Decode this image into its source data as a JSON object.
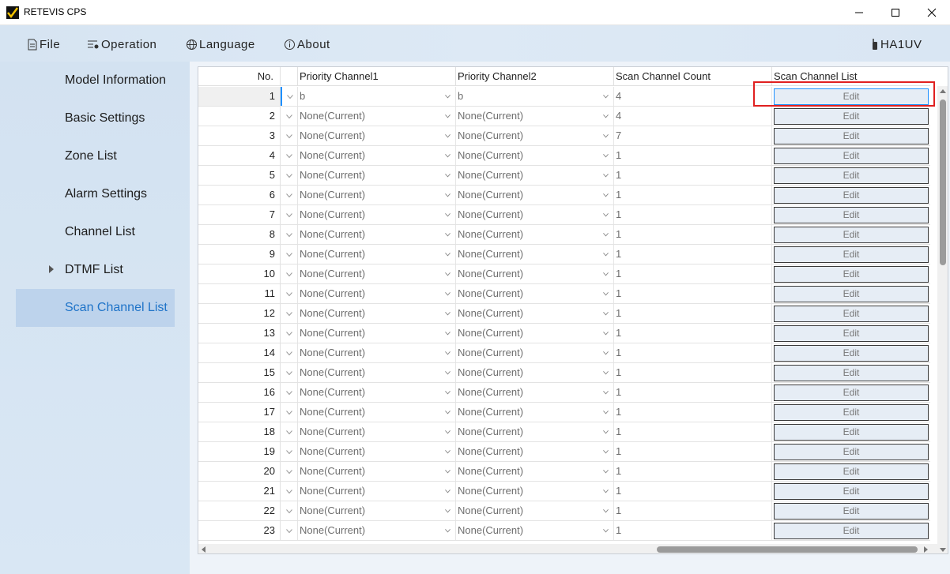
{
  "window": {
    "title": "RETEVIS CPS"
  },
  "menu": {
    "file": "File",
    "operation": "Operation",
    "language": "Language",
    "about": "About",
    "user": "HA1UV"
  },
  "sidebar": {
    "items": [
      {
        "label": "Model Information",
        "active": false,
        "expandable": false
      },
      {
        "label": "Basic Settings",
        "active": false,
        "expandable": false
      },
      {
        "label": "Zone List",
        "active": false,
        "expandable": false
      },
      {
        "label": "Alarm Settings",
        "active": false,
        "expandable": false
      },
      {
        "label": "Channel List",
        "active": false,
        "expandable": false
      },
      {
        "label": "DTMF List",
        "active": false,
        "expandable": true
      },
      {
        "label": "Scan Channel List",
        "active": true,
        "expandable": false
      }
    ]
  },
  "grid": {
    "columns": {
      "no": "No.",
      "priority1": "Priority Channel1",
      "priority2": "Priority Channel2",
      "count": "Scan Channel Count",
      "list": "Scan Channel List"
    },
    "edit_label": "Edit",
    "selected_row": 1,
    "rows": [
      {
        "no": "1",
        "p1": "b",
        "p2": "b",
        "count": "4"
      },
      {
        "no": "2",
        "p1": "None(Current)",
        "p2": "None(Current)",
        "count": "4"
      },
      {
        "no": "3",
        "p1": "None(Current)",
        "p2": "None(Current)",
        "count": "7"
      },
      {
        "no": "4",
        "p1": "None(Current)",
        "p2": "None(Current)",
        "count": "1"
      },
      {
        "no": "5",
        "p1": "None(Current)",
        "p2": "None(Current)",
        "count": "1"
      },
      {
        "no": "6",
        "p1": "None(Current)",
        "p2": "None(Current)",
        "count": "1"
      },
      {
        "no": "7",
        "p1": "None(Current)",
        "p2": "None(Current)",
        "count": "1"
      },
      {
        "no": "8",
        "p1": "None(Current)",
        "p2": "None(Current)",
        "count": "1"
      },
      {
        "no": "9",
        "p1": "None(Current)",
        "p2": "None(Current)",
        "count": "1"
      },
      {
        "no": "10",
        "p1": "None(Current)",
        "p2": "None(Current)",
        "count": "1"
      },
      {
        "no": "11",
        "p1": "None(Current)",
        "p2": "None(Current)",
        "count": "1"
      },
      {
        "no": "12",
        "p1": "None(Current)",
        "p2": "None(Current)",
        "count": "1"
      },
      {
        "no": "13",
        "p1": "None(Current)",
        "p2": "None(Current)",
        "count": "1"
      },
      {
        "no": "14",
        "p1": "None(Current)",
        "p2": "None(Current)",
        "count": "1"
      },
      {
        "no": "15",
        "p1": "None(Current)",
        "p2": "None(Current)",
        "count": "1"
      },
      {
        "no": "16",
        "p1": "None(Current)",
        "p2": "None(Current)",
        "count": "1"
      },
      {
        "no": "17",
        "p1": "None(Current)",
        "p2": "None(Current)",
        "count": "1"
      },
      {
        "no": "18",
        "p1": "None(Current)",
        "p2": "None(Current)",
        "count": "1"
      },
      {
        "no": "19",
        "p1": "None(Current)",
        "p2": "None(Current)",
        "count": "1"
      },
      {
        "no": "20",
        "p1": "None(Current)",
        "p2": "None(Current)",
        "count": "1"
      },
      {
        "no": "21",
        "p1": "None(Current)",
        "p2": "None(Current)",
        "count": "1"
      },
      {
        "no": "22",
        "p1": "None(Current)",
        "p2": "None(Current)",
        "count": "1"
      },
      {
        "no": "23",
        "p1": "None(Current)",
        "p2": "None(Current)",
        "count": "1"
      }
    ]
  },
  "colors": {
    "accent": "#1e73c8",
    "highlight": "#e02020",
    "selection": "#1e90ff"
  }
}
